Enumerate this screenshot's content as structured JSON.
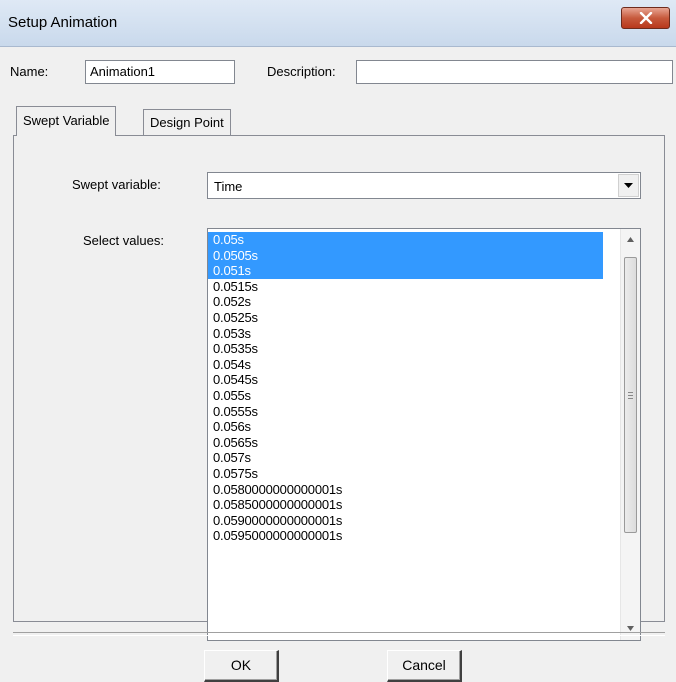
{
  "window": {
    "title": "Setup Animation",
    "close_icon": "close-x-icon"
  },
  "form": {
    "name_label": "Name:",
    "name_value": "Animation1",
    "description_label": "Description:",
    "description_value": ""
  },
  "tabs": [
    {
      "label": "Swept Variable",
      "active": true
    },
    {
      "label": "Design Point",
      "active": false
    }
  ],
  "swept": {
    "label": "Swept variable:",
    "selected": "Time"
  },
  "values": {
    "label": "Select values:",
    "items": [
      {
        "text": "0.05s",
        "selected": true
      },
      {
        "text": "0.0505s",
        "selected": true
      },
      {
        "text": "0.051s",
        "selected": true
      },
      {
        "text": "0.0515s",
        "selected": false
      },
      {
        "text": "0.052s",
        "selected": false
      },
      {
        "text": "0.0525s",
        "selected": false
      },
      {
        "text": "0.053s",
        "selected": false
      },
      {
        "text": "0.0535s",
        "selected": false
      },
      {
        "text": "0.054s",
        "selected": false
      },
      {
        "text": "0.0545s",
        "selected": false
      },
      {
        "text": "0.055s",
        "selected": false
      },
      {
        "text": "0.0555s",
        "selected": false
      },
      {
        "text": "0.056s",
        "selected": false
      },
      {
        "text": "0.0565s",
        "selected": false
      },
      {
        "text": "0.057s",
        "selected": false
      },
      {
        "text": "0.0575s",
        "selected": false
      },
      {
        "text": "0.0580000000000001s",
        "selected": false
      },
      {
        "text": "0.0585000000000001s",
        "selected": false
      },
      {
        "text": "0.0590000000000001s",
        "selected": false
      },
      {
        "text": "0.0595000000000001s",
        "selected": false
      }
    ]
  },
  "buttons": {
    "ok_label": "OK",
    "cancel_label": "Cancel"
  },
  "colors": {
    "selection": "#3399ff",
    "close_button": "#c75a3d"
  }
}
